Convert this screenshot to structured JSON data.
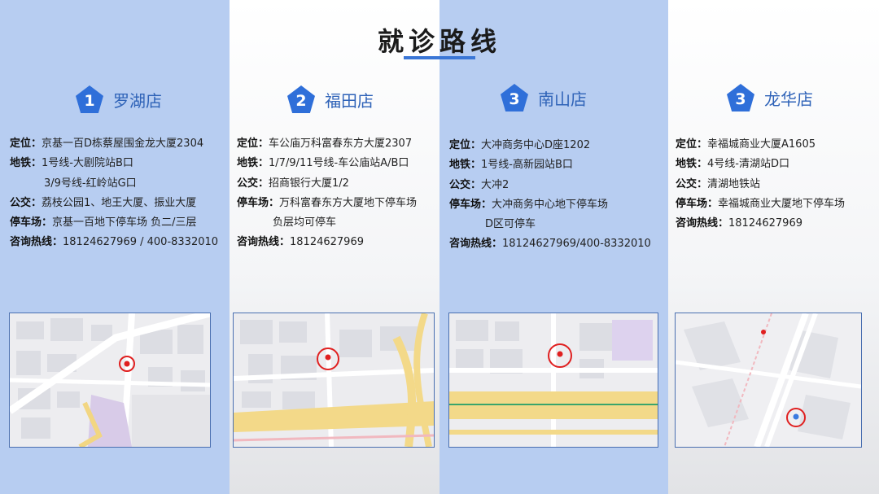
{
  "title": "就诊路线",
  "stores": [
    {
      "number": "1",
      "name": "罗湖店",
      "locate_label": "定位：",
      "locate": "京基一百D栋蔡屋围金龙大厦2304",
      "metro_label": "地铁：",
      "metro": "1号线-大剧院站B口",
      "metro2": "3/9号线-红岭站G口",
      "bus_label": "公交：",
      "bus": "荔枝公园1、地王大厦、振业大厦",
      "parking_label": "停车场：",
      "parking": "京基一百地下停车场 负二/三层",
      "hotline_label": "咨询热线：",
      "hotline": "18124627969 / 400-8332010"
    },
    {
      "number": "2",
      "name": "福田店",
      "locate_label": "定位：",
      "locate": "车公庙万科富春东方大厦2307",
      "metro_label": "地铁：",
      "metro": "1/7/9/11号线-车公庙站A/B口",
      "bus_label": "公交：",
      "bus": "招商银行大厦1/2",
      "parking_label": "停车场：",
      "parking": "万科富春东方大厦地下停车场",
      "parking2": "负层均可停车",
      "hotline_label": "咨询热线：",
      "hotline": "18124627969"
    },
    {
      "number": "3",
      "name": "南山店",
      "locate_label": "定位：",
      "locate": "大冲商务中心D座1202",
      "metro_label": "地铁：",
      "metro": "1号线-高新园站B口",
      "bus_label": "公交：",
      "bus": "大冲2",
      "parking_label": "停车场：",
      "parking": "大冲商务中心地下停车场",
      "parking2": "D区可停车",
      "hotline_label": "咨询热线：",
      "hotline": "18124627969/400-8332010"
    },
    {
      "number": "3",
      "name": "龙华店",
      "locate_label": "定位：",
      "locate": "幸福城商业大厦A1605",
      "metro_label": "地铁：",
      "metro": "4号线-清湖站D口",
      "bus_label": "公交：",
      "bus": "清湖地铁站",
      "parking_label": "停车场：",
      "parking": "幸福城商业大厦地下停车场",
      "hotline_label": "咨询热线：",
      "hotline": "18124627969"
    }
  ],
  "colors": {
    "accent": "#2f6fd9",
    "column_blue": "#b7cdf1",
    "marker_red": "#e02020"
  },
  "icons": [
    "pentagon-number-badge",
    "map-location-pin"
  ]
}
